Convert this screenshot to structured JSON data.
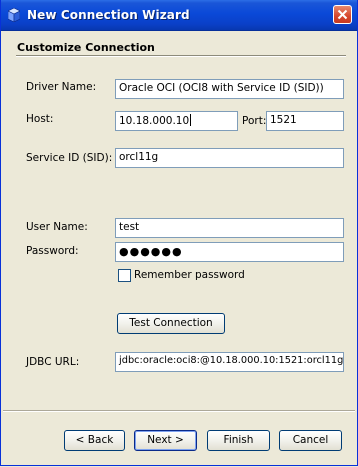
{
  "window": {
    "title": "New Connection Wizard",
    "title_icon": "cube-icon",
    "close_icon": "close-icon"
  },
  "section": {
    "title": "Customize Connection"
  },
  "form": {
    "driver_name_label": "Driver Name:",
    "driver_name_value": "Oracle OCI (OCI8 with Service ID (SID))",
    "host_label": "Host:",
    "host_value": "10.18.000.10",
    "port_label": "Port:",
    "port_value": "1521",
    "service_id_label": "Service ID (SID):",
    "service_id_value": "orcl11g",
    "user_name_label": "User Name:",
    "user_name_value": "test",
    "password_label": "Password:",
    "password_value": "●●●●●●",
    "remember_password_label": "Remember password",
    "remember_password_checked": false,
    "test_connection_label": "Test Connection",
    "jdbc_url_label": "JDBC URL:",
    "jdbc_url_value": "jdbc:oracle:oci8:@10.18.000.10:1521:orcl11g"
  },
  "footer": {
    "back_label": "< Back",
    "next_label": "Next >",
    "finish_label": "Finish",
    "cancel_label": "Cancel"
  },
  "colors": {
    "titlebar": "#0a49d8",
    "dialog_bg": "#ece9d8",
    "field_border": "#7f9db9",
    "button_border": "#003c74"
  }
}
